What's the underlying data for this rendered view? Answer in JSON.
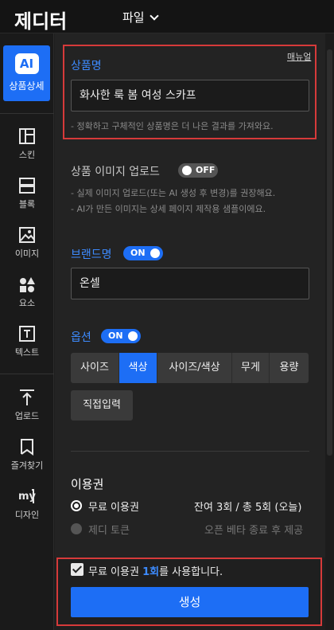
{
  "app": {
    "logo": "제디터",
    "file_menu": "파일"
  },
  "sidebar": {
    "ai_badge": "AI",
    "ai_label": "상품상세",
    "items": [
      {
        "label": "스킨",
        "icon": "layout-icon"
      },
      {
        "label": "블록",
        "icon": "block-icon"
      },
      {
        "label": "이미지",
        "icon": "image-icon"
      },
      {
        "label": "요소",
        "icon": "shapes-icon"
      },
      {
        "label": "텍스트",
        "icon": "text-icon"
      },
      {
        "label": "업로드",
        "icon": "upload-icon"
      },
      {
        "label": "즐겨찾기",
        "icon": "bookmark-icon"
      },
      {
        "label": "디자인",
        "icon": "my-design-icon"
      }
    ]
  },
  "product_name": {
    "label": "상품명",
    "manual_link": "매뉴얼",
    "value": "화사한 룩 봄 여성 스카프",
    "hint": "- 정확하고 구체적인 상품명은 더 나은 결과를 가져와요."
  },
  "product_image": {
    "label": "상품 이미지 업로드",
    "toggle": "OFF",
    "hints": [
      "- 실제 이미지 업로드(또는 AI 생성 후 변경)를 권장해요.",
      "- AI가 만든 이미지는 상세 페이지 제작용 샘플이에요."
    ]
  },
  "brand": {
    "label": "브랜드명",
    "toggle": "ON",
    "value": "온셀"
  },
  "options": {
    "label": "옵션",
    "toggle": "ON",
    "buttons": [
      "사이즈",
      "색상",
      "사이즈/색상",
      "무게",
      "용량"
    ],
    "selected": "색상",
    "direct_input": "직접입력"
  },
  "usage": {
    "title": "이용권",
    "free_label": "무료 이용권",
    "free_remaining": "잔여 3회 / 총 5회 (오늘)",
    "token_label": "제디 토큰",
    "token_note": "오픈 베타 종료 후 제공"
  },
  "confirm": {
    "prefix": "무료 이용권 ",
    "count": "1회",
    "suffix": "를 사용합니다.",
    "generate_button": "생성"
  },
  "colors": {
    "accent": "#1d6ef5",
    "highlight": "#d63a3a",
    "link_blue": "#3d8bff"
  }
}
